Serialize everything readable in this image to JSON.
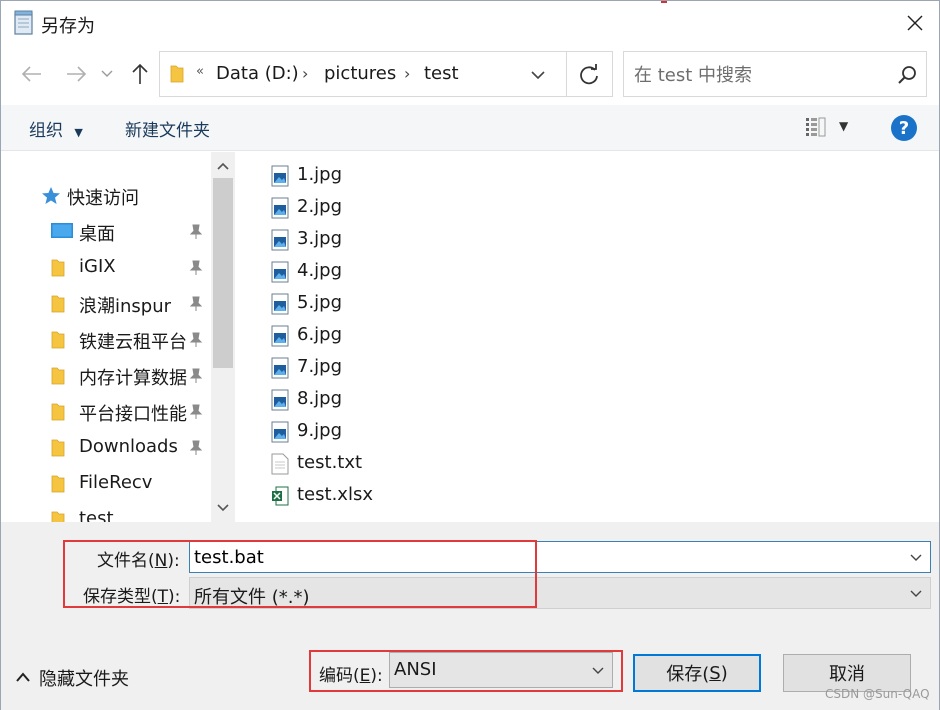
{
  "window": {
    "title": "另存为"
  },
  "address_bar": {
    "overflow_marker": "«",
    "crumbs": [
      "Data (D:)",
      "pictures",
      "test"
    ]
  },
  "search": {
    "placeholder": "在 test 中搜索"
  },
  "toolbar": {
    "organize_label": "组织",
    "new_folder_label": "新建文件夹"
  },
  "nav_pane": {
    "quick_access_label": "快速访问",
    "items": [
      {
        "label": "桌面",
        "pinned": true,
        "icon": "desktop-icon"
      },
      {
        "label": "iGIX",
        "pinned": true,
        "icon": "folder-icon"
      },
      {
        "label": "浪潮inspur",
        "pinned": true,
        "icon": "folder-icon"
      },
      {
        "label": "铁建云租平台",
        "pinned": true,
        "icon": "folder-icon"
      },
      {
        "label": "内存计算数据",
        "pinned": true,
        "icon": "folder-icon"
      },
      {
        "label": "平台接口性能",
        "pinned": true,
        "icon": "folder-icon"
      },
      {
        "label": "Downloads",
        "pinned": true,
        "icon": "folder-icon"
      },
      {
        "label": "FileRecv",
        "pinned": false,
        "icon": "folder-icon"
      },
      {
        "label": "test",
        "pinned": false,
        "icon": "folder-icon"
      }
    ]
  },
  "files": [
    {
      "name": "1.jpg",
      "icon": "image-file-icon"
    },
    {
      "name": "2.jpg",
      "icon": "image-file-icon"
    },
    {
      "name": "3.jpg",
      "icon": "image-file-icon"
    },
    {
      "name": "4.jpg",
      "icon": "image-file-icon"
    },
    {
      "name": "5.jpg",
      "icon": "image-file-icon"
    },
    {
      "name": "6.jpg",
      "icon": "image-file-icon"
    },
    {
      "name": "7.jpg",
      "icon": "image-file-icon"
    },
    {
      "name": "8.jpg",
      "icon": "image-file-icon"
    },
    {
      "name": "9.jpg",
      "icon": "image-file-icon"
    },
    {
      "name": "test.txt",
      "icon": "text-file-icon"
    },
    {
      "name": "test.xlsx",
      "icon": "excel-file-icon"
    }
  ],
  "form": {
    "filename_label_pre": "文件名(",
    "filename_label_key": "N",
    "filename_label_post": "):",
    "filename_value": "test.bat",
    "type_label_pre": "保存类型(",
    "type_label_key": "T",
    "type_label_post": "):",
    "type_value": "所有文件  (*.*)",
    "encoding_label_pre": "编码(",
    "encoding_label_key": "E",
    "encoding_label_post": "):",
    "encoding_value": "ANSI"
  },
  "footer": {
    "hide_folders_label": "隐藏文件夹",
    "save_label_pre": "保存(",
    "save_label_key": "S",
    "save_label_post": ")",
    "cancel_label": "取消",
    "watermark": "CSDN @Sun-QAQ"
  },
  "colors": {
    "accent": "#0078d7",
    "highlight_frame": "#e03a3a",
    "folder": "#f5c542",
    "help": "#1a73c9"
  }
}
